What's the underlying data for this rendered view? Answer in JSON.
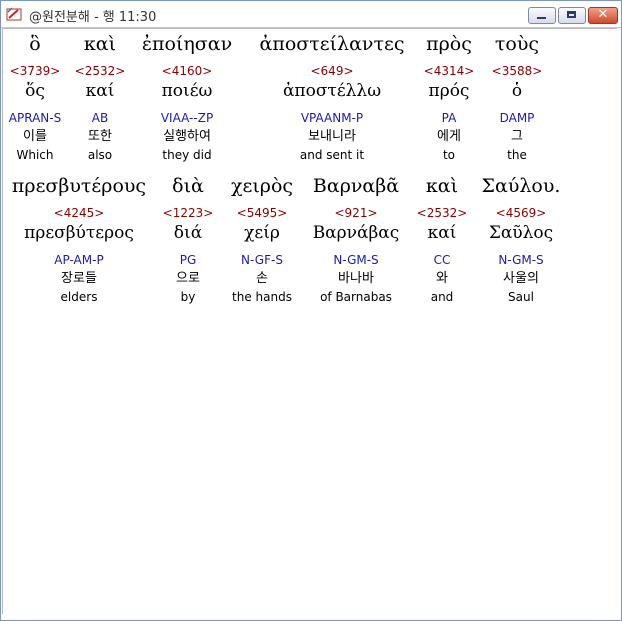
{
  "window": {
    "title": "@원전분해 - 행 11:30"
  },
  "rows": [
    [
      {
        "greek": "ὃ",
        "strong": "<3739>",
        "lemma": "ὅς",
        "morph": "APRAN-S",
        "korean": "이를",
        "english": "Which"
      },
      {
        "greek": "καὶ",
        "strong": "<2532>",
        "lemma": "καί",
        "morph": "AB",
        "korean": "또한",
        "english": "also"
      },
      {
        "greek": "ἐποίησαν",
        "strong": "<4160>",
        "lemma": "ποιέω",
        "morph": "VIAA--ZP",
        "korean": "실행하여",
        "english": "they did"
      },
      {
        "greek": "ἀποστείλαντες",
        "strong": "<649>",
        "lemma": "ἀποστέλλω",
        "morph": "VPAANM-P",
        "korean": "보내니라",
        "english": "and sent it"
      },
      {
        "greek": "πρὸς",
        "strong": "<4314>",
        "lemma": "πρός",
        "morph": "PA",
        "korean": "에게",
        "english": "to"
      },
      {
        "greek": "τοὺς",
        "strong": "<3588>",
        "lemma": "ὁ",
        "morph": "DAMP",
        "korean": "그",
        "english": "the"
      }
    ],
    [
      {
        "greek": "πρεσβυτέρους",
        "strong": "<4245>",
        "lemma": "πρεσβύτερος",
        "morph": "AP-AM-P",
        "korean": "장로들",
        "english": "elders"
      },
      {
        "greek": "διὰ",
        "strong": "<1223>",
        "lemma": "διά",
        "morph": "PG",
        "korean": "으로",
        "english": "by"
      },
      {
        "greek": "χειρὸς",
        "strong": "<5495>",
        "lemma": "χείρ",
        "morph": "N-GF-S",
        "korean": "손",
        "english": "the hands"
      },
      {
        "greek": "Βαρναβᾶ",
        "strong": "<921>",
        "lemma": "Βαρνάβας",
        "morph": "N-GM-S",
        "korean": "바나바",
        "english": "of Barnabas"
      },
      {
        "greek": "καὶ",
        "strong": "<2532>",
        "lemma": "καί",
        "morph": "CC",
        "korean": "와",
        "english": "and"
      },
      {
        "greek": "Σαύλου.",
        "strong": "<4569>",
        "lemma": "Σαῦλος",
        "morph": "N-GM-S",
        "korean": "사울의",
        "english": "Saul"
      }
    ]
  ]
}
